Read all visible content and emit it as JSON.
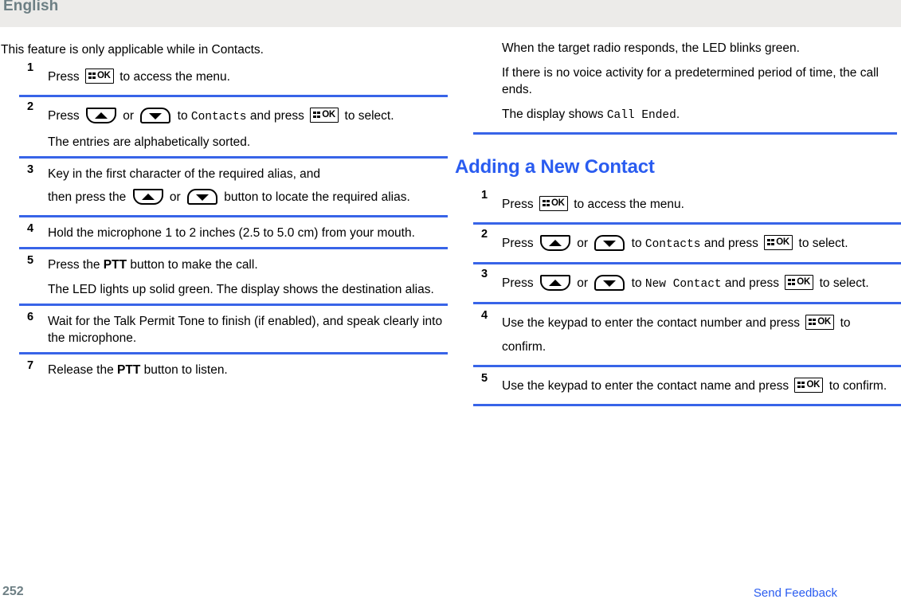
{
  "header": {
    "language_label": "English",
    "band_color": "#ecebe9",
    "text_color": "#6d7f84"
  },
  "theme": {
    "rule_color": "#3864e8",
    "heading_color": "#2a5cf0",
    "link_color": "#2a5cf0"
  },
  "icons": {
    "ok_label": "OK",
    "menu_ok_name": "menu-ok-key-icon",
    "up_name": "up-arrow-key-icon",
    "down_name": "down-arrow-key-icon"
  },
  "left_column": {
    "intro": "This feature is only applicable while in Contacts.",
    "steps": [
      {
        "num": "1",
        "parts": [
          {
            "t": "text",
            "v": "Press "
          },
          {
            "t": "key",
            "v": "ok"
          },
          {
            "t": "text",
            "v": " to access the menu."
          }
        ],
        "text_plain": "Press [OK] to access the menu."
      },
      {
        "num": "2",
        "text_plain": "Press [UP] or [DOWN] to Contacts and press [OK] to select.",
        "lead": "Press ",
        "mid1": " or ",
        "mid2": " to ",
        "screen": "Contacts",
        "mid3": " and press ",
        "tail": " to select.",
        "note": "The entries are alphabetically sorted."
      },
      {
        "num": "3",
        "line1": "Key in the first character of the required alias, and",
        "line2a": "then press the ",
        "line2b": " or ",
        "line2c": " button to locate the required alias."
      },
      {
        "num": "4",
        "text": "Hold the microphone 1 to 2 inches (2.5 to 5.0 cm) from your mouth."
      },
      {
        "num": "5",
        "lead": "Press the ",
        "strong": "PTT",
        "tail": " button to make the call.",
        "note": "The LED lights up solid green. The display shows the destination alias."
      },
      {
        "num": "6",
        "text": "Wait for the Talk Permit Tone to finish (if enabled), and speak clearly into the microphone."
      },
      {
        "num": "7",
        "lead": "Release the ",
        "strong": "PTT",
        "tail": " button to listen."
      }
    ]
  },
  "right_column": {
    "continued_paragraphs": [
      "When the target radio responds, the LED blinks green.",
      "If there is no voice activity for a predetermined period of time, the call ends."
    ],
    "display_line": {
      "lead": "The display shows ",
      "screen": "Call Ended",
      "tail": "."
    },
    "section_title": "Adding a New Contact",
    "steps": [
      {
        "num": "1",
        "lead": "Press ",
        "tail": " to access the menu."
      },
      {
        "num": "2",
        "lead": "Press ",
        "mid1": " or ",
        "mid2": " to ",
        "screen": "Contacts",
        "mid3": " and press ",
        "tail": " to select."
      },
      {
        "num": "3",
        "lead": "Press ",
        "mid1": " or ",
        "mid2": " to ",
        "screen": "New Contact",
        "mid3": " and press ",
        "tail": " to select."
      },
      {
        "num": "4",
        "lead": "Use the keypad to enter the contact number and press ",
        "tail": " to confirm."
      },
      {
        "num": "5",
        "lead": "Use the keypad to enter the contact name and press ",
        "tail": " to confirm."
      }
    ]
  },
  "footer": {
    "page_number": "252",
    "send_feedback": "Send Feedback"
  }
}
